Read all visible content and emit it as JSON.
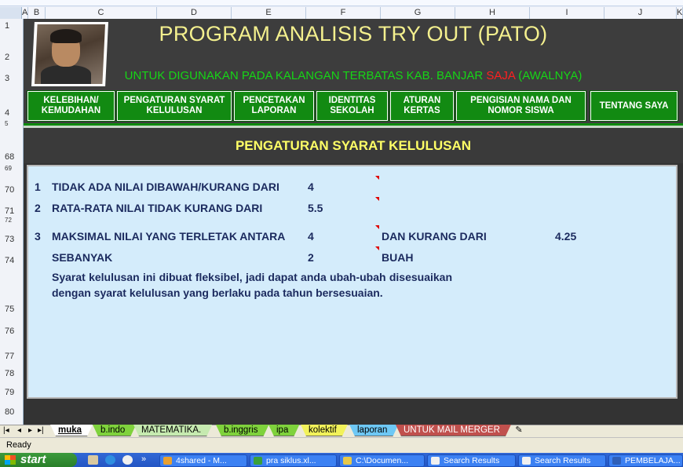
{
  "columns": [
    "A",
    "B",
    "C",
    "D",
    "E",
    "F",
    "G",
    "H",
    "I",
    "J",
    "K"
  ],
  "rows": [
    "1",
    "2",
    "3",
    "4",
    "5",
    "68",
    "69",
    "70",
    "71",
    "72",
    "73",
    "74",
    "75",
    "76",
    "77",
    "78",
    "79",
    "80"
  ],
  "header": {
    "title": "PROGRAM ANALISIS TRY OUT (PATO)",
    "subtitle_before": "UNTUK DIGUNAKAN PADA KALANGAN TERBATAS KAB. BANJAR ",
    "subtitle_red": "SAJA",
    "subtitle_after": " (AWALNYA)"
  },
  "nav": [
    {
      "line1": "KELEBIHAN/",
      "line2": "KEMUDAHAN"
    },
    {
      "line1": "PENGATURAN SYARAT",
      "line2": "KELULUSAN"
    },
    {
      "line1": "PENCETAKAN",
      "line2": "LAPORAN"
    },
    {
      "line1": "IDENTITAS",
      "line2": "SEKOLAH"
    },
    {
      "line1": "ATURAN",
      "line2": "KERTAS"
    },
    {
      "line1": "PENGISIAN NAMA DAN",
      "line2": "NOMOR SISWA"
    },
    {
      "line1": "TENTANG SAYA",
      "line2": ""
    }
  ],
  "section": {
    "title": "PENGATURAN SYARAT KELULUSAN",
    "rule1": {
      "num": "1",
      "label": "TIDAK ADA NILAI DIBAWAH/KURANG DARI",
      "value": "4"
    },
    "rule2": {
      "num": "2",
      "label": "RATA-RATA NILAI TIDAK KURANG DARI",
      "value": "5.5"
    },
    "rule3": {
      "num": "3",
      "label": "MAKSIMAL NILAI YANG TERLETAK ANTARA",
      "value": "4",
      "label2": "DAN KURANG DARI",
      "value2": "4.25"
    },
    "rule3b": {
      "label": "SEBANYAK",
      "value": "2",
      "label2": "BUAH"
    },
    "description": "Syarat kelulusan ini dibuat fleksibel, jadi dapat anda ubah-ubah disesuaikan dengan syarat kelulusan yang berlaku pada tahun bersesuaian."
  },
  "tabs": [
    {
      "label": "muka",
      "color": "#ffffff"
    },
    {
      "label": "b.indo",
      "color": "#7fd23c"
    },
    {
      "label": "MATEMATIKA.",
      "color": "#c6eab0"
    },
    {
      "label": "b.inggris",
      "color": "#7fd23c"
    },
    {
      "label": "ipa",
      "color": "#7fd23c"
    },
    {
      "label": "kolektif",
      "color": "#f2f25a"
    },
    {
      "label": "laporan",
      "color": "#6ec8f5"
    },
    {
      "label": "UNTUK MAIL MERGER",
      "color": "#c0504d"
    }
  ],
  "status": {
    "text": "Ready"
  },
  "taskbar": {
    "start": "start",
    "items": [
      "4shared - M...",
      "pra siklus.xl...",
      "C:\\Documen...",
      "Search Results",
      "Search Results",
      "PEMBELAJA..."
    ]
  }
}
